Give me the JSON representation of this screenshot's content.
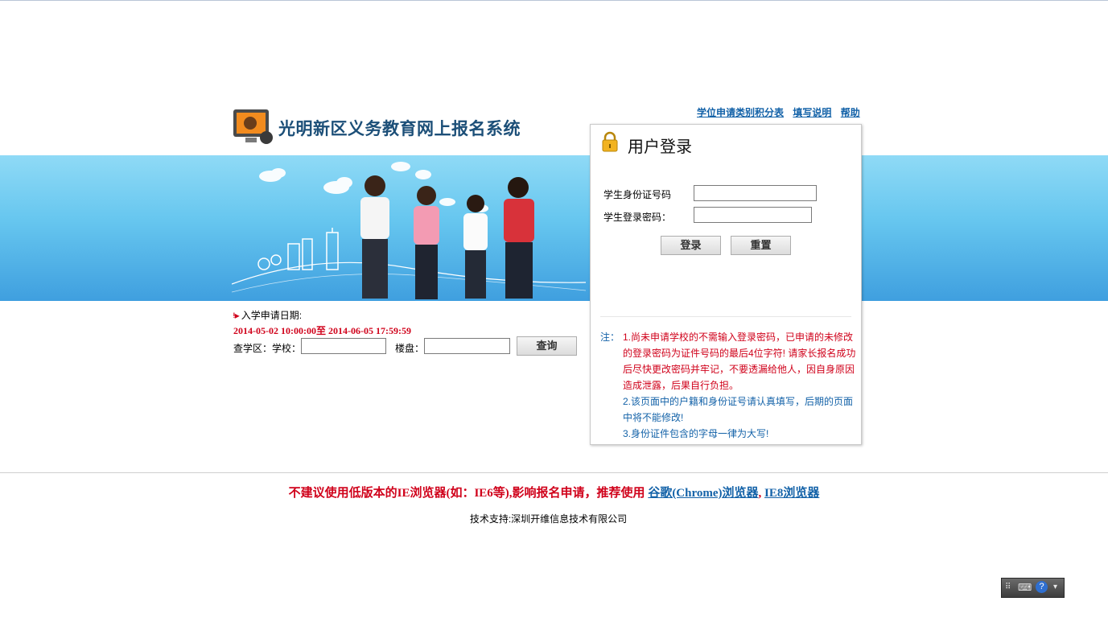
{
  "header": {
    "site_title": "光明新区义务教育网上报名系统",
    "links": [
      "学位申请类别积分表",
      "填写说明",
      "帮助"
    ]
  },
  "login": {
    "title": "用户登录",
    "id_label": "学生身份证号码",
    "id_value": "",
    "password_label": "学生登录密码：",
    "password_value": "",
    "login_button": "登录",
    "reset_button": "重置",
    "notes_prefix": "注：",
    "note1": "1.尚未申请学校的不需输入登录密码，已申请的未修改的登录密码为证件号码的最后4位字符! 请家长报名成功后尽快更改密码并牢记，不要透漏给他人，因自身原因造成泄露，后果自行负担。",
    "note2": "2.该页面中的户籍和身份证号请认真填写，后期的页面中将不能修改!",
    "note3": "3.身份证件包含的字母一律为大写!"
  },
  "query": {
    "period_label": "入学申请日期:",
    "period_value": "2014-05-02 10:00:00至 2014-06-05 17:59:59",
    "district_label": "查学区：学校：",
    "school_value": "",
    "building_label": "楼盘：",
    "building_value": "",
    "search_button": "查询"
  },
  "footer": {
    "warning_text": "不建议使用低版本的IE浏览器(如：IE6等),影响报名申请，推荐使用",
    "chrome_link": "谷歌(Chrome)浏览器",
    "separator": ",",
    "ie8_link": "IE8浏览器",
    "support": "技术支持:深圳开维信息技术有限公司"
  },
  "colors": {
    "accent_blue": "#1362a8",
    "warning_red": "#d0021b",
    "banner_blue": "#66c6ef"
  },
  "icons": [
    "monitor-logo-icon",
    "lock-icon",
    "keyboard-icon",
    "help-icon"
  ]
}
